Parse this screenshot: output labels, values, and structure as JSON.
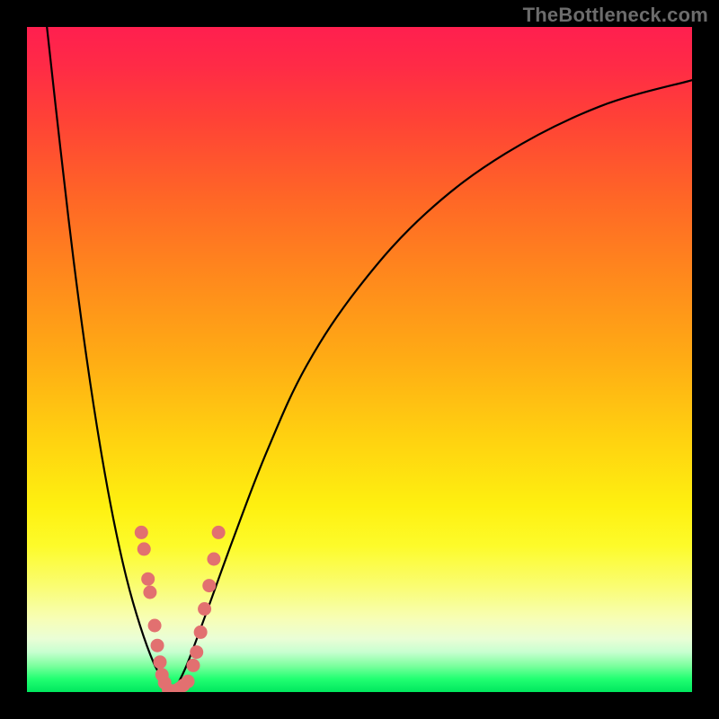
{
  "watermark": "TheBottleneck.com",
  "chart_data": {
    "type": "line",
    "title": "",
    "xlabel": "",
    "ylabel": "",
    "xlim": [
      0,
      100
    ],
    "ylim": [
      0,
      100
    ],
    "grid": false,
    "legend": false,
    "series": [
      {
        "name": "bottleneck-curve-left",
        "color": "#000000",
        "x": [
          3,
          5,
          7,
          9,
          11,
          13,
          15,
          17,
          19,
          20.5,
          22
        ],
        "y": [
          100,
          82,
          65,
          50,
          37,
          26,
          17,
          10,
          4.5,
          1.8,
          0
        ]
      },
      {
        "name": "bottleneck-curve-right",
        "color": "#000000",
        "x": [
          22,
          24,
          27,
          31,
          36,
          42,
          50,
          60,
          72,
          86,
          100
        ],
        "y": [
          0,
          4,
          12,
          23,
          36,
          49,
          61,
          72,
          81,
          88,
          92
        ]
      }
    ],
    "markers": [
      {
        "name": "data-points-left",
        "color": "#e27070",
        "x": [
          17.2,
          17.6,
          18.2,
          18.5,
          19.2,
          19.6,
          20.0,
          20.3,
          20.7
        ],
        "y": [
          24.0,
          21.5,
          17.0,
          15.0,
          10.0,
          7.0,
          4.5,
          2.6,
          1.4
        ]
      },
      {
        "name": "data-points-bottom",
        "color": "#e27070",
        "x": [
          21.3,
          21.8,
          22.3,
          22.9,
          23.5,
          24.2
        ],
        "y": [
          0.3,
          0.1,
          0.2,
          0.5,
          1.0,
          1.6
        ]
      },
      {
        "name": "data-points-right",
        "color": "#e27070",
        "x": [
          25.0,
          25.5,
          26.1,
          26.7,
          27.4,
          28.1,
          28.8
        ],
        "y": [
          4.0,
          6.0,
          9.0,
          12.5,
          16.0,
          20.0,
          24.0
        ]
      }
    ],
    "background_gradient": {
      "type": "vertical",
      "stops": [
        {
          "pos": 0.0,
          "color": "#ff1f4f"
        },
        {
          "pos": 0.5,
          "color": "#ffac14"
        },
        {
          "pos": 0.78,
          "color": "#fdfb2a"
        },
        {
          "pos": 0.96,
          "color": "#7eff9f"
        },
        {
          "pos": 1.0,
          "color": "#00e75e"
        }
      ]
    }
  }
}
